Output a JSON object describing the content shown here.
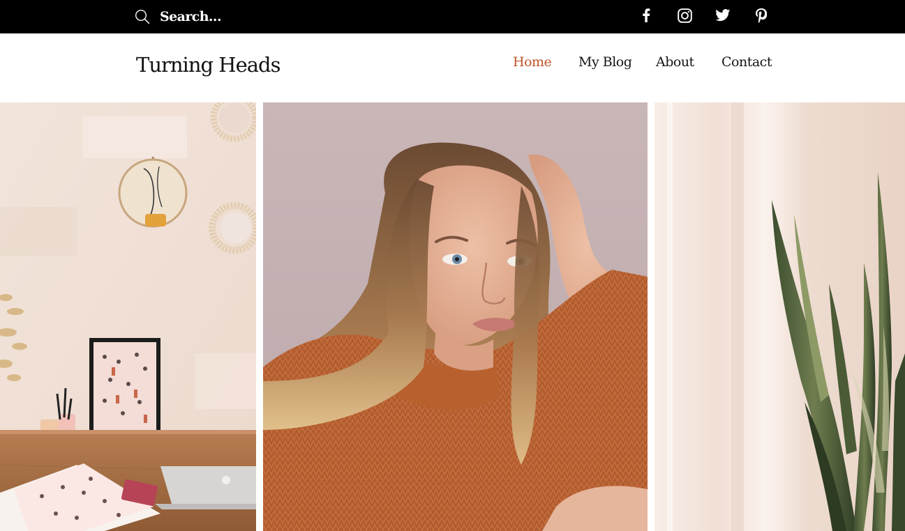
{
  "topbar": {
    "search_placeholder": "Search...",
    "social_icons": [
      "facebook-icon",
      "instagram-icon",
      "twitter-icon",
      "pinterest-icon"
    ]
  },
  "header": {
    "site_title": "Turning Heads",
    "nav": [
      {
        "label": "Home",
        "active": true
      },
      {
        "label": "My Blog",
        "active": false
      },
      {
        "label": "About",
        "active": false
      },
      {
        "label": "Contact",
        "active": false
      }
    ]
  },
  "gallery": {
    "images": [
      "desk-workspace-image",
      "woman-portrait-image",
      "plant-curtain-image"
    ]
  },
  "colors": {
    "topbar_bg": "#000000",
    "accent": "#C0542B",
    "text": "#151515",
    "background": "#FFFFFF"
  }
}
